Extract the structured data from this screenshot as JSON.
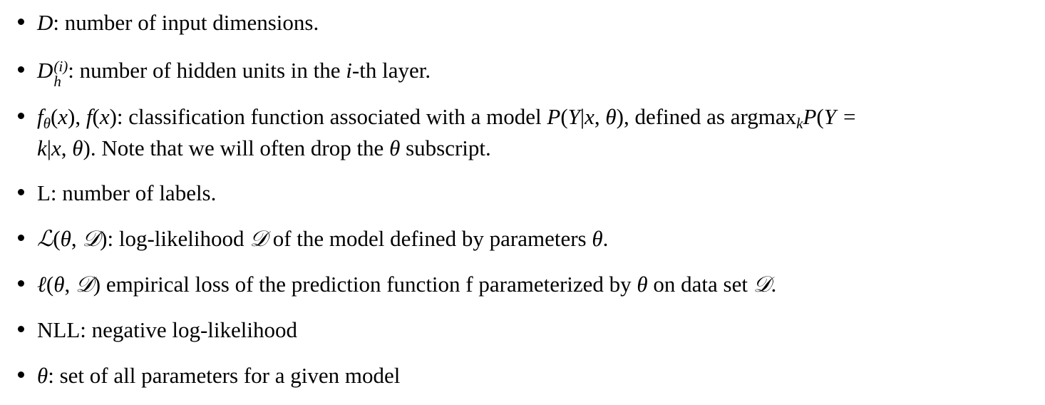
{
  "items": [
    {
      "text": ": number of input dimensions."
    },
    {
      "text": ": number of hidden units in the ",
      "text_mid": "-th layer."
    },
    {
      "text": " classification function associated with a model ",
      "text_mid": ", defined as ",
      "text_end": ". Note that we will often drop the ",
      "text_tail": " subscript."
    },
    {
      "text": "L: number of labels."
    },
    {
      "text": ": log-likelihood ",
      "text_mid": " of the model defined by parameters ",
      "text_end": "."
    },
    {
      "text": " empirical loss of the prediction function f parameterized by ",
      "text_mid": " on data set ",
      "text_end": "."
    },
    {
      "text": "NLL: negative log-likelihood"
    },
    {
      "text": ": set of all parameters for a given model"
    }
  ]
}
